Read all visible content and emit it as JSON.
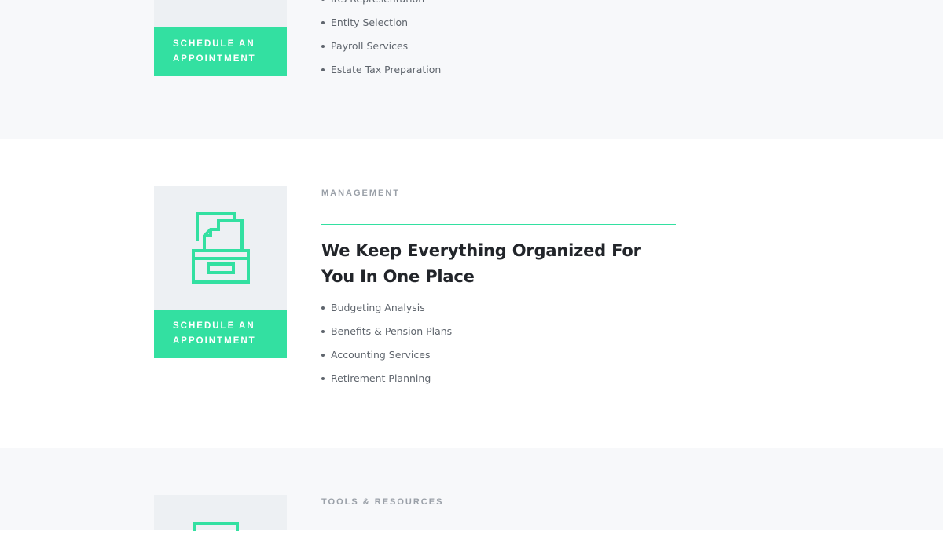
{
  "sections": [
    {
      "cta_line1": "SCHEDULE AN",
      "cta_line2": "APPOINTMENT",
      "items": [
        "IRS Representation",
        "Entity Selection",
        "Payroll Services",
        "Estate Tax Preparation"
      ]
    },
    {
      "eyebrow": "MANAGEMENT",
      "heading_line1": "We Keep Everything Organized For",
      "heading_line2": "You In One Place",
      "icon": "file-cabinet-icon",
      "cta_line1": "SCHEDULE AN",
      "cta_line2": "APPOINTMENT",
      "items": [
        "Budgeting Analysis",
        "Benefits & Pension Plans",
        "Accounting Services",
        "Retirement Planning"
      ]
    },
    {
      "eyebrow": "TOOLS & RESOURCES",
      "icon": "tools-icon"
    }
  ],
  "colors": {
    "accent": "#33e0a1",
    "card": "#edf0f3",
    "band": "#f7f8fa"
  }
}
